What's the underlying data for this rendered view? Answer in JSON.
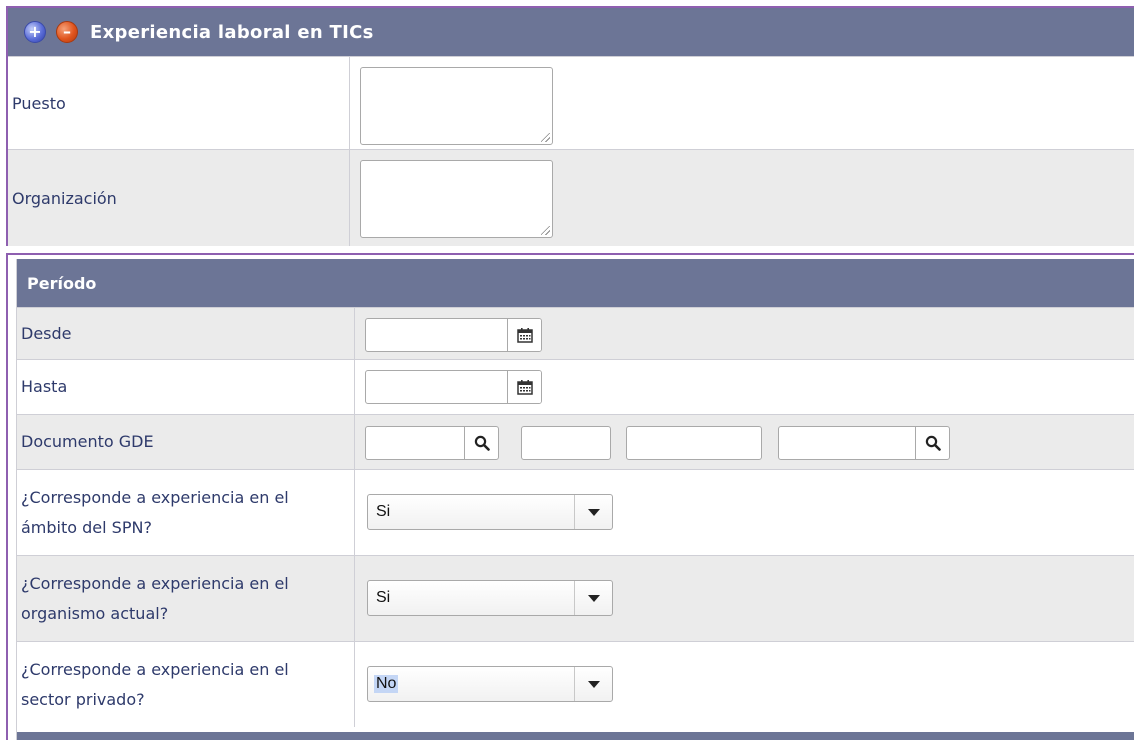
{
  "section1": {
    "title": "Experiencia laboral en TICs",
    "expand_icon": "plus-circle-icon",
    "collapse_icon": "minus-circle-icon",
    "rows": [
      {
        "label": "Puesto",
        "value": ""
      },
      {
        "label": "Organización",
        "value": ""
      }
    ]
  },
  "section2": {
    "title": "Período",
    "desde": {
      "label": "Desde",
      "value": "",
      "icon": "calendar-icon"
    },
    "hasta": {
      "label": "Hasta",
      "value": "",
      "icon": "calendar-icon"
    },
    "documento": {
      "label": "Documento GDE",
      "field1": "",
      "field2": "",
      "field3": "",
      "field4": "",
      "icon": "search-icon"
    },
    "questions": [
      {
        "line1": "¿Corresponde a experiencia en el",
        "line2": "ámbito del SPN?",
        "value": "Si"
      },
      {
        "line1": "¿Corresponde a experiencia en el",
        "line2": "organismo actual?",
        "value": "Si"
      },
      {
        "line1": "¿Corresponde a experiencia en el",
        "line2": "sector privado?",
        "value": "No"
      }
    ]
  },
  "colors": {
    "header_bg": "#6c7596",
    "section_border": "#8e5fb0",
    "label_text": "#2e3a6b",
    "row_alt_bg": "#ebebeb"
  }
}
